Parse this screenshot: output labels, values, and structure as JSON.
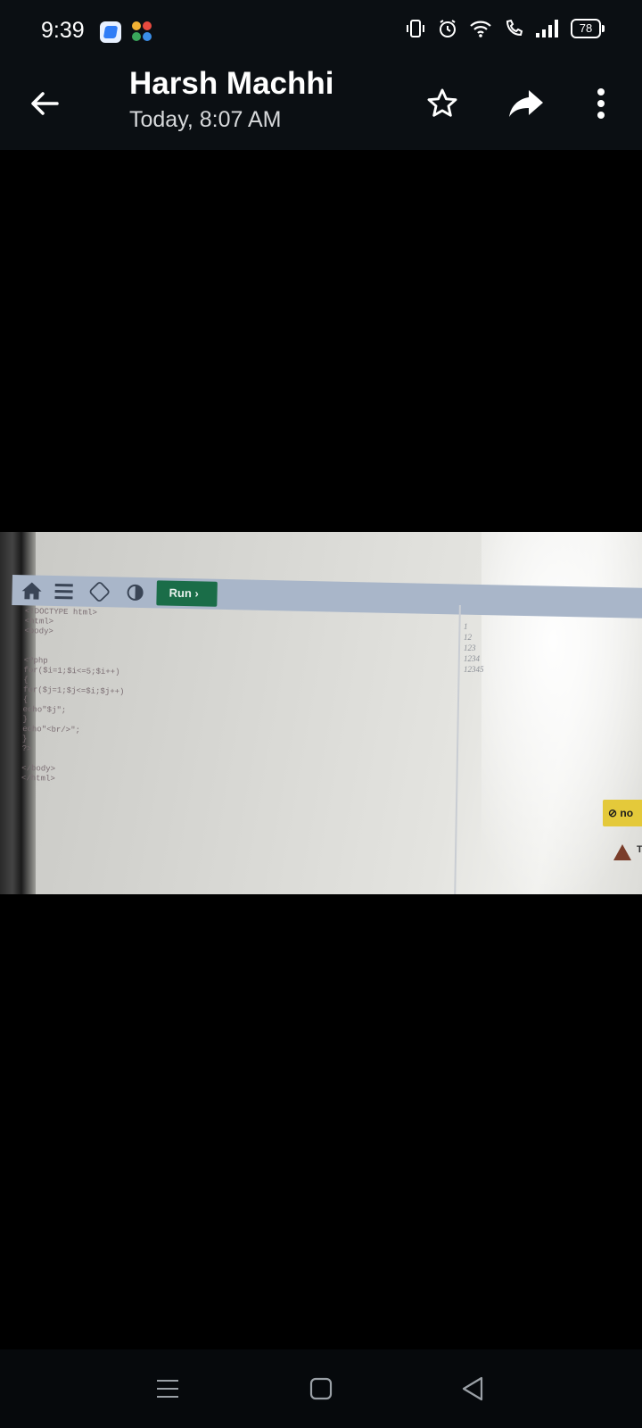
{
  "status": {
    "time": "9:39",
    "battery": "78",
    "icons": [
      "app-icon-blue",
      "app-icon-multicolor",
      "vibrate-icon",
      "alarm-icon",
      "wifi-icon",
      "wifi-calling-icon",
      "signal-icon",
      "battery-icon"
    ]
  },
  "header": {
    "title": "Harsh Machhi",
    "subtitle": "Today, 8:07 AM",
    "actions": [
      "back-arrow-icon",
      "star-icon",
      "share-icon",
      "more-vert-icon"
    ]
  },
  "photo": {
    "run_label": "Run",
    "code_lines": [
      "<!DOCTYPE html>",
      "<html>",
      "<body>",
      "",
      "",
      "<?php",
      "for($i=1;$i<=5;$i++)",
      "{",
      "for($j=1;$j<=$i;$j++)",
      "{",
      "echo\"$j\";",
      "}",
      "echo\"<br/>\";",
      "}",
      "?>",
      "",
      "</body>",
      "</html>"
    ],
    "output_lines": [
      "1",
      "12",
      "123",
      "1234",
      "12345"
    ],
    "badge_text": "no",
    "warning_text": "T"
  },
  "navbar": {
    "icons": [
      "recent-apps-icon",
      "home-icon",
      "back-icon"
    ]
  }
}
